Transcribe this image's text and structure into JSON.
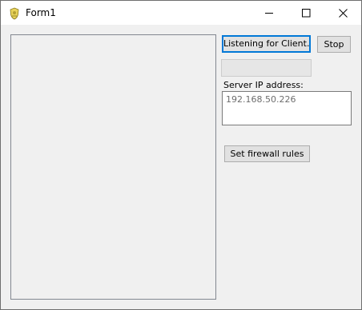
{
  "window": {
    "title": "Form1",
    "app_icon": "shield-crest-icon",
    "controls": {
      "minimize_icon": "minimize-icon",
      "maximize_icon": "maximize-icon",
      "close_icon": "close-icon"
    }
  },
  "buttons": {
    "listen_label": "Listening for Client...",
    "stop_label": "Stop",
    "firewall_label": "Set firewall rules"
  },
  "server": {
    "label": "Server IP address:",
    "ip_value": "192.168.50.226"
  },
  "colors": {
    "window_bg": "#f0f0f0",
    "default_button_border": "#0078d7",
    "button_bg": "#e1e1e1"
  }
}
